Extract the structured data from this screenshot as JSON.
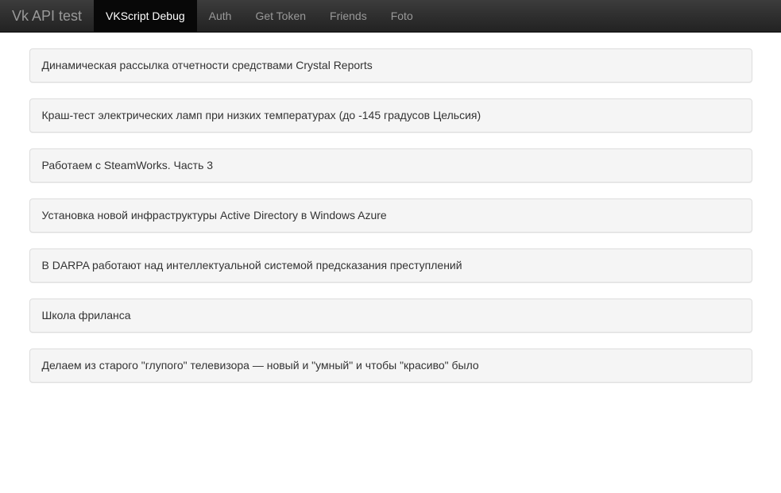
{
  "navbar": {
    "brand": "Vk API test",
    "items": [
      {
        "label": "VKScript Debug",
        "active": true
      },
      {
        "label": "Auth",
        "active": false
      },
      {
        "label": "Get Token",
        "active": false
      },
      {
        "label": "Friends",
        "active": false
      },
      {
        "label": "Foto",
        "active": false
      }
    ]
  },
  "posts": [
    {
      "title": "Динамическая рассылка отчетности средствами Crystal Reports"
    },
    {
      "title": "Краш-тест электрических ламп при низких температурах (до -145 градусов Цельсия)"
    },
    {
      "title": "Работаем с SteamWorks. Часть 3"
    },
    {
      "title": "Установка новой инфраструктуры Active Directory в Windows Azure"
    },
    {
      "title": "В DARPA работают над интеллектуальной системой предсказания преступлений"
    },
    {
      "title": "Школа фриланса"
    },
    {
      "title": "Делаем из старого \"глупого\" телевизора — новый и \"умный\" и чтобы \"красиво\" было"
    }
  ]
}
